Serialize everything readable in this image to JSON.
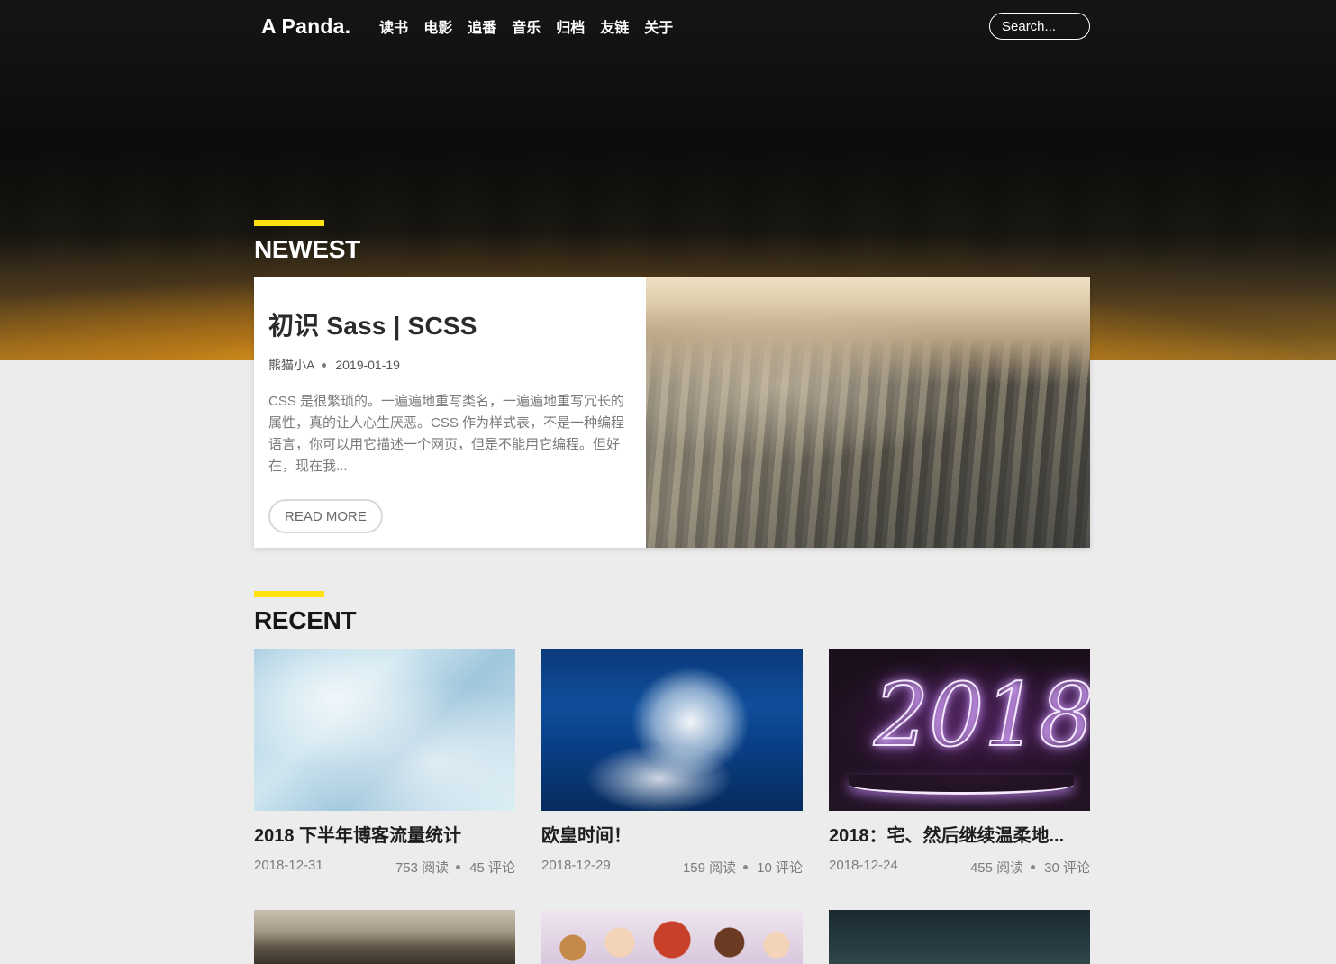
{
  "header": {
    "logo": "A Panda.",
    "nav": [
      "读书",
      "电影",
      "追番",
      "音乐",
      "归档",
      "友链",
      "关于"
    ],
    "search_placeholder": "Search..."
  },
  "newest": {
    "heading": "NEWEST",
    "post": {
      "title": "初识 Sass | SCSS",
      "author": "熊猫小A",
      "date": "2019-01-19",
      "excerpt": "CSS 是很繁琐的。一遍遍地重写类名，一遍遍地重写冗长的属性，真的让人心生厌恶。CSS 作为样式表，不是一种编程语言，你可以用它描述一个网页，但是不能用它编程。但好在，现在我...",
      "read_more": "READ MORE"
    }
  },
  "recent": {
    "heading": "RECENT",
    "posts": [
      {
        "title": "2018 下半年博客流量统计",
        "date": "2018-12-31",
        "reads": "753 阅读",
        "comments": "45 评论"
      },
      {
        "title": "欧皇时间！",
        "date": "2018-12-29",
        "reads": "159 阅读",
        "comments": "10 评论"
      },
      {
        "title": "2018：宅、然后继续温柔地...",
        "date": "2018-12-24",
        "reads": "455 阅读",
        "comments": "30 评论"
      }
    ],
    "card_image_text": "2018"
  },
  "colors": {
    "accent": "#ffe10f",
    "background": "#ececec",
    "card_bg": "#ffffff",
    "text_dark": "#1e1e1e",
    "text_muted": "#7b7b7b"
  }
}
